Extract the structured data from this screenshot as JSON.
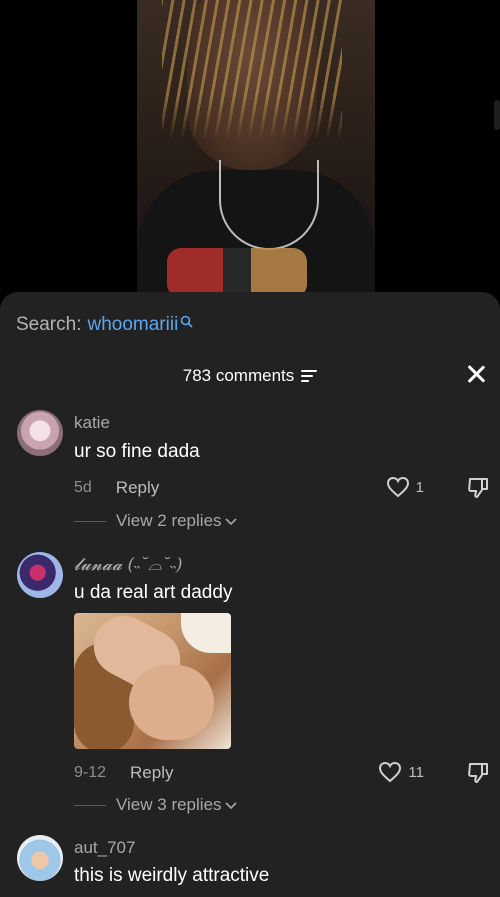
{
  "search": {
    "label": "Search:",
    "term": "whoomariii"
  },
  "header": {
    "comment_count": "783 comments"
  },
  "comments": [
    {
      "username": "katie",
      "text": "ur so fine dada",
      "age": "5d",
      "reply_label": "Reply",
      "likes": "1",
      "view_replies": "View 2 replies"
    },
    {
      "username": "𝓵𝓾𝓷𝓪𝓪 (˵˘⌓˘˵)",
      "text": "u da real art daddy",
      "age": "9-12",
      "reply_label": "Reply",
      "likes": "11",
      "view_replies": "View 3 replies",
      "has_image": true
    },
    {
      "username": "aut_707",
      "text": "this is weirdly attractive"
    }
  ],
  "colors": {
    "sheet_bg": "#222222",
    "link_blue": "#5aa7ee",
    "muted_text": "#a8a8a8"
  },
  "icons": [
    "search-icon",
    "filter-icon",
    "close-icon",
    "heart-icon",
    "dislike-icon",
    "chevron-down-icon"
  ]
}
